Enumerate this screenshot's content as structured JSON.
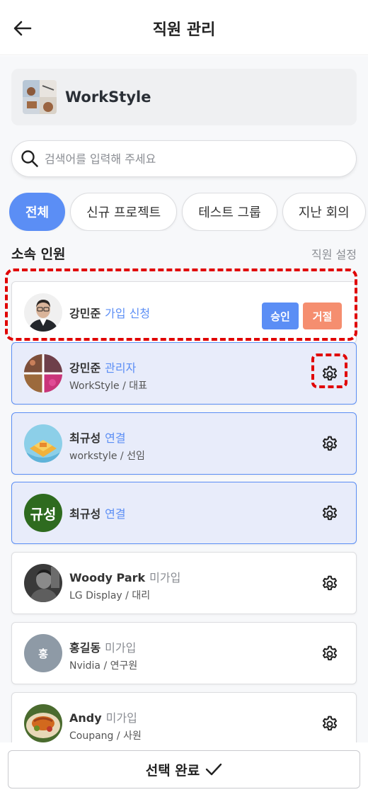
{
  "header": {
    "title": "직원 관리"
  },
  "company": {
    "name": "WorkStyle"
  },
  "search": {
    "placeholder": "검색어를 입력해 주세요"
  },
  "tabs": [
    {
      "label": "전체",
      "active": true
    },
    {
      "label": "신규 프로젝트",
      "active": false
    },
    {
      "label": "테스트 그룹",
      "active": false
    },
    {
      "label": "지난 회의",
      "active": false
    }
  ],
  "section": {
    "title": "소속 인원",
    "settings_link": "직원 설정"
  },
  "pending_request": {
    "name": "강민준",
    "status": "가입 신청",
    "approve_label": "승인",
    "reject_label": "거절"
  },
  "members": [
    {
      "name": "강민준",
      "status": "관리자",
      "company": "WorkStyle",
      "role": "대표",
      "connected": true
    },
    {
      "name": "최규성",
      "status": "연결",
      "company": "workstyle",
      "role": "선임",
      "connected": true
    },
    {
      "name": "최규성",
      "status": "연결",
      "avatar_text": "규성",
      "connected": true
    },
    {
      "name": "Woody Park",
      "status": "미가입",
      "company": "LG Display",
      "role": "대리",
      "connected": false
    },
    {
      "name": "홍길동",
      "status": "미가입",
      "company": "Nvidia",
      "role": "연구원",
      "avatar_text": "홍",
      "connected": false
    },
    {
      "name": "Andy",
      "status": "미가입",
      "company": "Coupang",
      "role": "사원",
      "connected": false
    }
  ],
  "footer": {
    "complete_label": "선택 완료"
  },
  "colors": {
    "accent": "#5b8ef5",
    "reject": "#f58e6f",
    "highlight": "#e00000",
    "connected_bg": "#e8ecfa"
  }
}
